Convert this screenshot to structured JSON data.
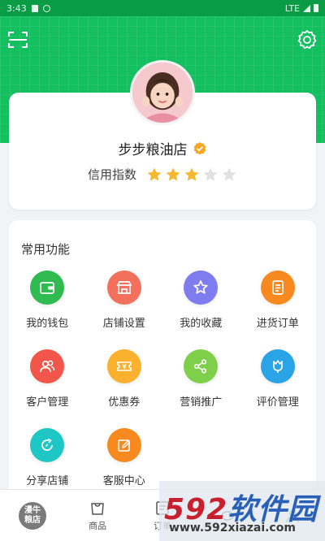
{
  "status_bar": {
    "time": "3:43",
    "network": "LTE"
  },
  "profile": {
    "store_name": "步步粮油店",
    "credit_label": "信用指数",
    "credit_rating": 3,
    "credit_max": 5
  },
  "functions": {
    "title": "常用功能",
    "items": [
      {
        "label": "我的钱包",
        "icon": "wallet-icon",
        "color": "#2fbb4f"
      },
      {
        "label": "店铺设置",
        "icon": "store-icon",
        "color": "#f2705c"
      },
      {
        "label": "我的收藏",
        "icon": "star-icon",
        "color": "#7f7cf0"
      },
      {
        "label": "进货订单",
        "icon": "order-icon",
        "color": "#f7891f"
      },
      {
        "label": "客户管理",
        "icon": "customers-icon",
        "color": "#f2564a"
      },
      {
        "label": "优惠券",
        "icon": "coupon-icon",
        "color": "#fbb12e"
      },
      {
        "label": "营销推广",
        "icon": "share-icon",
        "color": "#7ed04b"
      },
      {
        "label": "评价管理",
        "icon": "review-icon",
        "color": "#2aa4e6"
      },
      {
        "label": "分享店铺",
        "icon": "share-store-icon",
        "color": "#1fc6c6"
      },
      {
        "label": "客服中心",
        "icon": "service-icon",
        "color": "#f7891f"
      }
    ]
  },
  "bottom_nav": {
    "logo_text": "漫牛粮店",
    "items": [
      {
        "label": "商品"
      },
      {
        "label": "订单"
      }
    ]
  },
  "watermark": {
    "brand_a": "592",
    "brand_b": "软件园",
    "url": "www.592xiazai.com"
  },
  "colors": {
    "brand_green": "#13c060",
    "star_active": "#f5b82e",
    "star_inactive": "#e1e1e1"
  }
}
